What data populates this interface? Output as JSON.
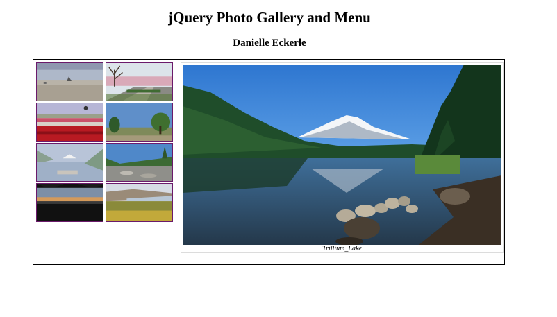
{
  "header": {
    "title": "jQuery Photo Gallery and Menu",
    "author": "Danielle Eckerle"
  },
  "gallery": {
    "thumbnail_border_color": "#6b1a6b",
    "thumbnails": [
      {
        "scene": "beach-haystack-rock"
      },
      {
        "scene": "boardwalk-cherry-blossoms"
      },
      {
        "scene": "tulip-field-balloon"
      },
      {
        "scene": "field-with-trees"
      },
      {
        "scene": "misty-lake-mountain"
      },
      {
        "scene": "rocky-riverbed"
      },
      {
        "scene": "sunset-silhouette"
      },
      {
        "scene": "gorge-wildflowers"
      }
    ],
    "main_photo": {
      "scene": "mountain-lake-reflection",
      "caption": "Trillium_Lake"
    }
  }
}
